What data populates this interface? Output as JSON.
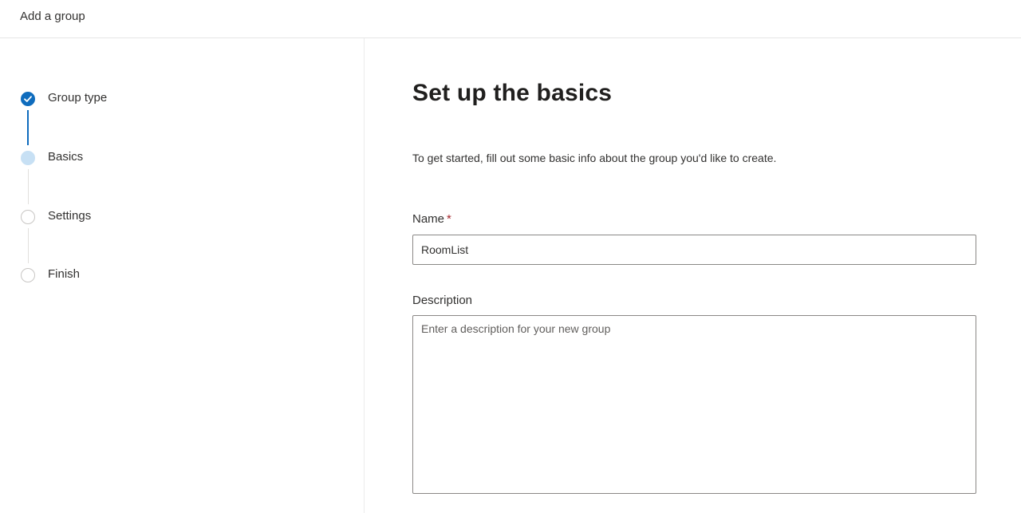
{
  "header": {
    "title": "Add a group"
  },
  "wizard": {
    "steps": [
      {
        "label": "Group type",
        "state": "done"
      },
      {
        "label": "Basics",
        "state": "current"
      },
      {
        "label": "Settings",
        "state": "pending"
      },
      {
        "label": "Finish",
        "state": "pending"
      }
    ]
  },
  "main": {
    "title": "Set up the basics",
    "intro": "To get started, fill out some basic info about the group you'd like to create.",
    "name_field": {
      "label": "Name",
      "required_marker": "*",
      "value": "RoomList"
    },
    "description_field": {
      "label": "Description",
      "value": "",
      "placeholder": "Enter a description for your new group"
    }
  },
  "colors": {
    "accent": "#0f6cbd",
    "current_step": "#c7e0f4",
    "required": "#a4262c"
  },
  "icons": {
    "done_step": "checkmark-icon"
  }
}
